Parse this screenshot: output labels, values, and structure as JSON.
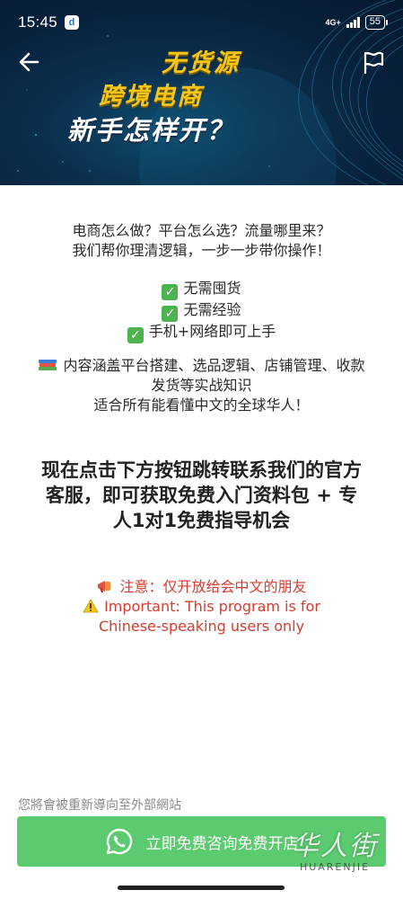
{
  "status_bar": {
    "time": "15:45",
    "app_icon_letter": "d",
    "network": "4G+",
    "battery": "55"
  },
  "banner": {
    "title_line1": "无货源",
    "title_line2": "跨境电商",
    "title_line3": "新手怎样开？",
    "colors": {
      "accent": "#f5c518",
      "background": "#0b2f4d"
    }
  },
  "intro": {
    "line1": "电商怎么做？平台怎么选？流量哪里来？",
    "line2": "我们帮你理清逻辑，一步一步带你操作！"
  },
  "checks": [
    {
      "icon": "check-mark-icon",
      "text": "无需囤货"
    },
    {
      "icon": "check-mark-icon",
      "text": "无需经验"
    },
    {
      "icon": "check-mark-icon",
      "text": "手机+网络即可上手"
    }
  ],
  "coverage": {
    "icon": "books-icon",
    "line1": "内容涵盖平台搭建、选品逻辑、店铺管理、收款",
    "line2": "发货等实战知识",
    "line3": "适合所有能看懂中文的全球华人！"
  },
  "cta": {
    "line1": "现在点击下方按钮跳转联系我们的官方",
    "line2": "客服，即可获取免费入门资料包 + 专",
    "line3": "人1对1免费指导机会"
  },
  "notice": {
    "line1_icon": "megaphone-icon",
    "line1": "注意：仅开放给会中文的朋友",
    "line2_icon": "warning-icon",
    "line2": "Important: This program is for",
    "line3": "Chinese-speaking users only",
    "color": "#d63b2f"
  },
  "footer": {
    "redirect_note": "您將會被重新導向至外部網站",
    "button_label": "立即免费咨询免费开店",
    "button_color": "#5ccb70",
    "watermark_cn": "华人街",
    "watermark_en": "HUARENJIE"
  }
}
